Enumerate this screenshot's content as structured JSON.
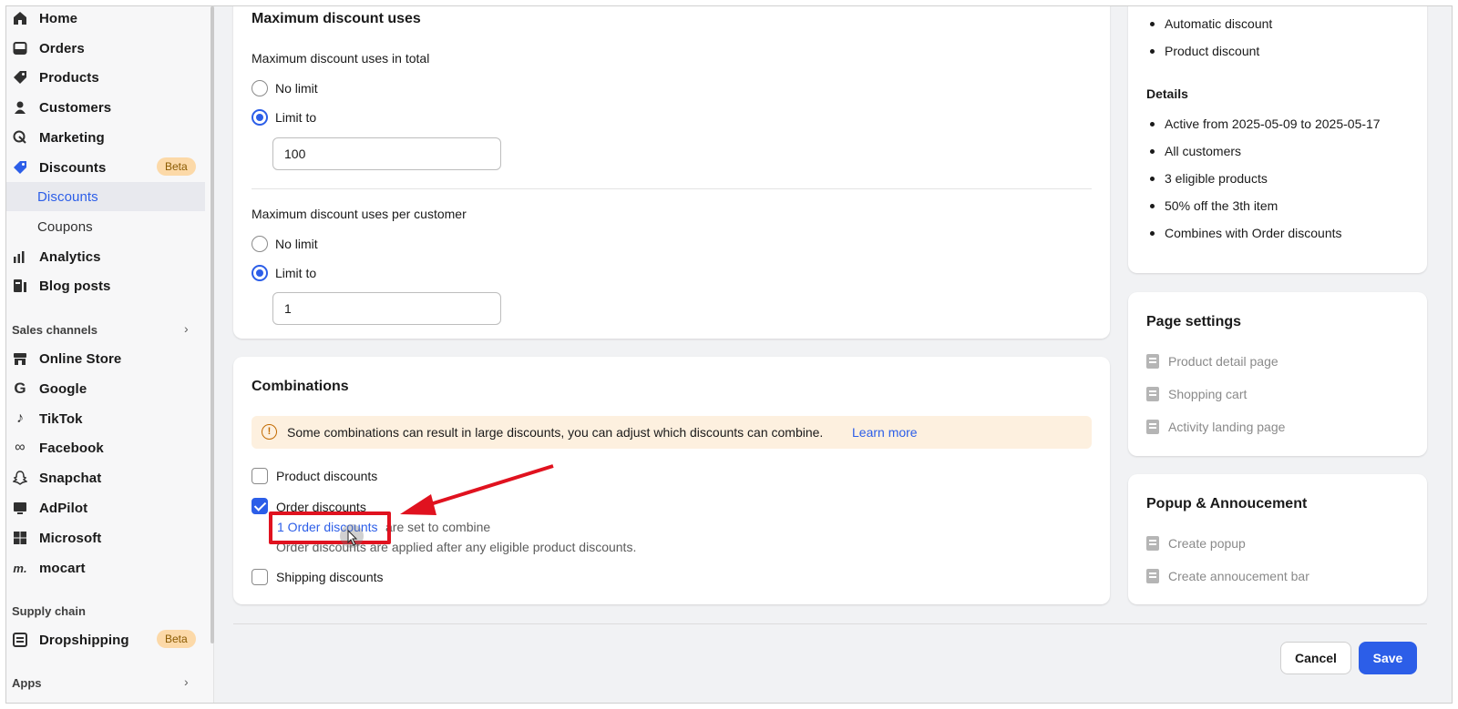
{
  "sidebar": {
    "items": [
      {
        "label": "Home",
        "icon": "home-icon"
      },
      {
        "label": "Orders",
        "icon": "orders-icon"
      },
      {
        "label": "Products",
        "icon": "tag-icon"
      },
      {
        "label": "Customers",
        "icon": "person-icon"
      },
      {
        "label": "Marketing",
        "icon": "marketing-icon"
      },
      {
        "label": "Discounts",
        "icon": "discount-icon",
        "badge": "Beta"
      }
    ],
    "discount_sub": [
      {
        "label": "Discounts"
      },
      {
        "label": "Coupons"
      }
    ],
    "items2": [
      {
        "label": "Analytics",
        "icon": "analytics-icon"
      },
      {
        "label": "Blog posts",
        "icon": "blog-icon"
      }
    ],
    "sales_channels_title": "Sales channels",
    "channels": [
      {
        "label": "Online Store",
        "icon": "store-icon"
      },
      {
        "label": "Google",
        "icon": "google-icon"
      },
      {
        "label": "TikTok",
        "icon": "tiktok-icon"
      },
      {
        "label": "Facebook",
        "icon": "meta-icon"
      },
      {
        "label": "Snapchat",
        "icon": "snapchat-icon"
      },
      {
        "label": "AdPilot",
        "icon": "adpilot-icon"
      },
      {
        "label": "Microsoft",
        "icon": "microsoft-icon"
      },
      {
        "label": "mocart",
        "icon": "mocart-icon"
      }
    ],
    "supply_chain_title": "Supply chain",
    "dropshipping": {
      "label": "Dropshipping",
      "badge": "Beta"
    },
    "apps_title": "Apps"
  },
  "max_uses": {
    "title": "Maximum discount uses",
    "total_label": "Maximum discount uses in total",
    "no_limit": "No limit",
    "limit_to": "Limit to",
    "total_value": "100",
    "per_customer_label": "Maximum discount uses per customer",
    "per_customer_value": "1"
  },
  "combinations": {
    "title": "Combinations",
    "warning": "Some combinations can result in large discounts, you can adjust which discounts can combine.",
    "learn_more": "Learn more",
    "product_discounts": "Product discounts",
    "order_discounts": "Order discounts",
    "order_link": "1 Order discounts",
    "order_link_suffix": "are set to combine",
    "order_note": "Order discounts are applied after any eligible product discounts.",
    "shipping_discounts": "Shipping discounts"
  },
  "summary": {
    "type_items": [
      "Automatic discount",
      "Product discount"
    ],
    "details_title": "Details",
    "details": [
      "Active from 2025-05-09 to 2025-05-17",
      "All customers",
      "3 eligible products",
      "50% off the 3th item",
      "Combines with Order discounts"
    ]
  },
  "page_settings": {
    "title": "Page settings",
    "items": [
      "Product detail page",
      "Shopping cart",
      "Activity landing page"
    ]
  },
  "popup": {
    "title": "Popup & Annoucement",
    "items": [
      "Create popup",
      "Create annoucement bar"
    ]
  },
  "footer": {
    "cancel": "Cancel",
    "save": "Save"
  },
  "colors": {
    "accent": "#2c5ee8",
    "annotation": "#e0121f",
    "warning_bg": "#fdf0df",
    "badge_bg": "#fcd9a8"
  }
}
